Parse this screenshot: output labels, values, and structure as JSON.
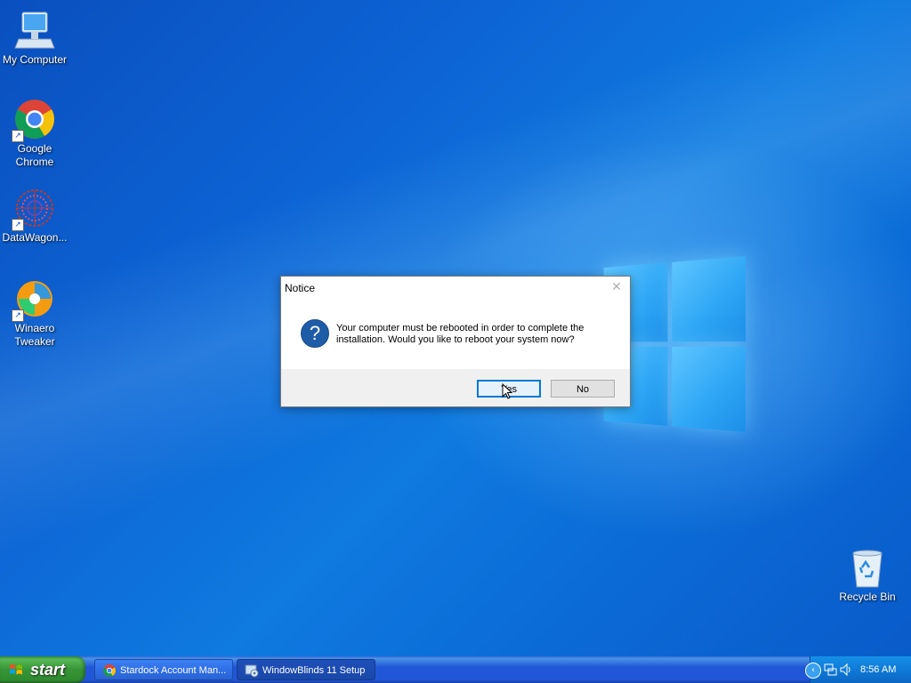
{
  "desktop": {
    "icons": [
      {
        "label": "My Computer",
        "icon": "monitor-icon"
      },
      {
        "label": "Google Chrome",
        "icon": "chrome-icon"
      },
      {
        "label": "DataWagon...",
        "icon": "datawagon-icon"
      },
      {
        "label": "Winaero Tweaker",
        "icon": "winaero-icon"
      },
      {
        "label": "Recycle Bin",
        "icon": "recycle-bin-icon"
      }
    ]
  },
  "dialog": {
    "title": "Notice",
    "message": "Your computer must be rebooted in order to complete the installation. Would you like to reboot your system now?",
    "yes_label": "Yes",
    "no_label": "No",
    "icon": "question-icon"
  },
  "taskbar": {
    "start_label": "start",
    "tasks": [
      {
        "label": "Stardock Account Man...",
        "icon": "chrome-icon"
      },
      {
        "label": "WindowBlinds 11 Setup",
        "icon": "setup-icon"
      }
    ],
    "clock": "8:56 AM"
  },
  "colors": {
    "accent": "#0078d7",
    "taskbar": "#2157d7",
    "start": "#379537"
  }
}
